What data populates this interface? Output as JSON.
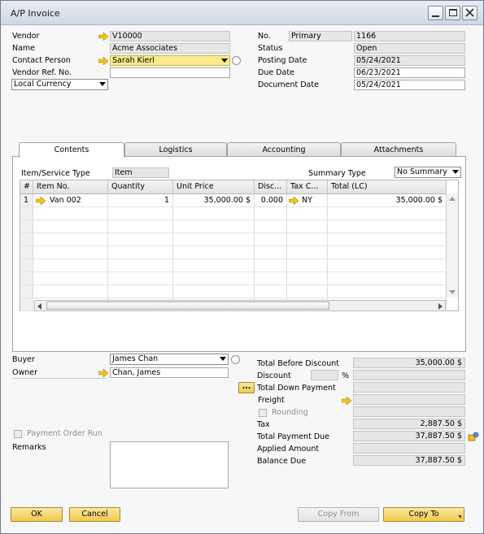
{
  "window": {
    "title": "A/P Invoice"
  },
  "header": {
    "vendor_label": "Vendor",
    "vendor_value": "V10000",
    "name_label": "Name",
    "name_value": "Acme Associates",
    "contact_label": "Contact Person",
    "contact_value": "Sarah Kierl",
    "ref_label": "Vendor Ref. No.",
    "ref_value": "",
    "currency_value": "Local Currency",
    "no_label": "No.",
    "no_series": "Primary",
    "no_value": "1166",
    "status_label": "Status",
    "status_value": "Open",
    "posting_label": "Posting Date",
    "posting_value": "05/24/2021",
    "due_label": "Due Date",
    "due_value": "06/23/2021",
    "docdate_label": "Document Date",
    "docdate_value": "05/24/2021"
  },
  "tabs": [
    "Contents",
    "Logistics",
    "Accounting",
    "Attachments"
  ],
  "contents": {
    "type_label": "Item/Service Type",
    "type_value": "Item",
    "summary_label": "Summary Type",
    "summary_value": "No Summary",
    "columns": [
      "#",
      "Item No.",
      "Quantity",
      "Unit Price",
      "Disc...",
      "Tax C...",
      "Total (LC)"
    ],
    "rows": [
      {
        "num": "1",
        "item": "Van 002",
        "qty": "1",
        "price": "35,000.00 $",
        "disc": "0.000",
        "tax": "NY",
        "total": "35,000.00 $"
      }
    ]
  },
  "footer": {
    "buyer_label": "Buyer",
    "buyer_value": "James Chan",
    "owner_label": "Owner",
    "owner_value": "Chan, James",
    "payment_order_label": "Payment Order Run",
    "remarks_label": "Remarks",
    "tbd_label": "Total Before Discount",
    "tbd_value": "35,000.00 $",
    "discount_label": "Discount",
    "discount_pct": "%",
    "tdp_label": "Total Down Payment",
    "tdp_btn": "...",
    "freight_label": "Freight",
    "rounding_label": "Rounding",
    "tax_label": "Tax",
    "tax_value": "2,887.50 $",
    "tpd_label": "Total Payment Due",
    "tpd_value": "37,887.50 $",
    "applied_label": "Applied Amount",
    "balance_label": "Balance Due",
    "balance_value": "37,887.50 $"
  },
  "buttons": {
    "ok": "OK",
    "cancel": "Cancel",
    "copy_from": "Copy From",
    "copy_to": "Copy To"
  }
}
